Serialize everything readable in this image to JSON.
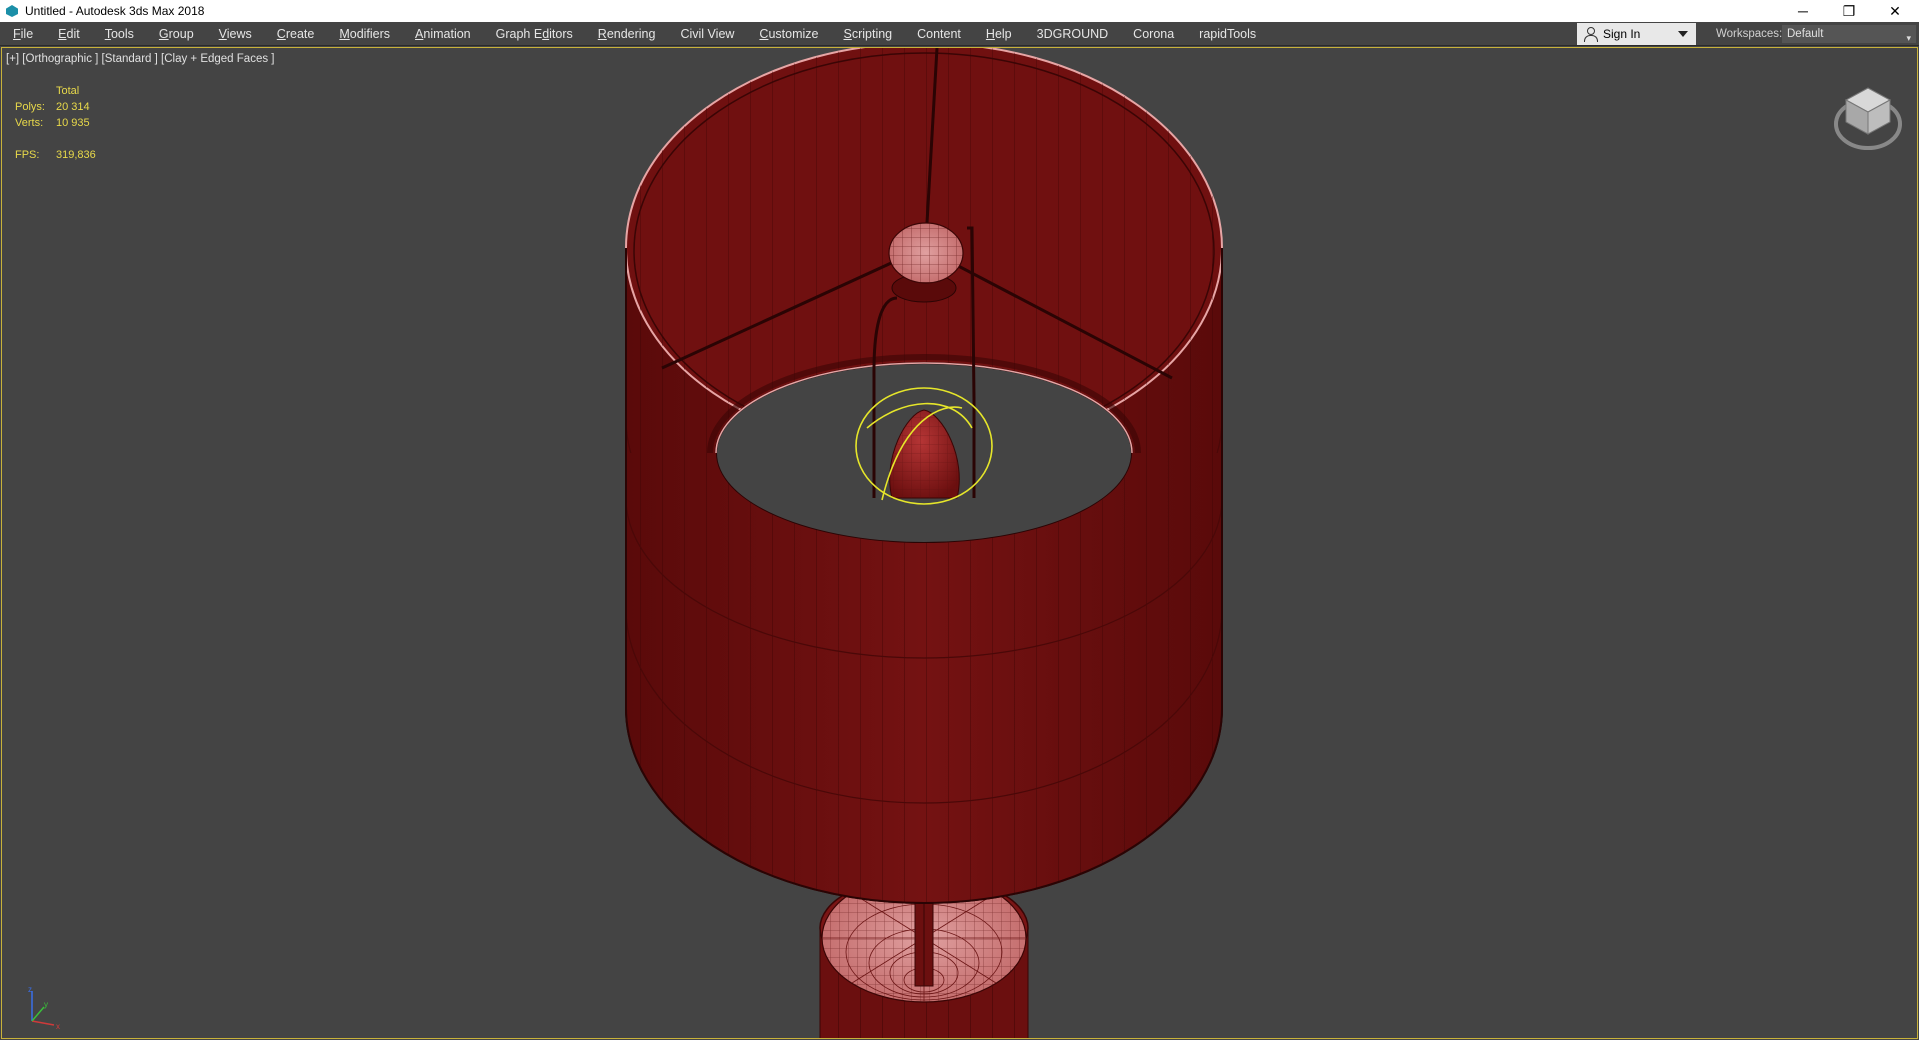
{
  "window": {
    "title": "Untitled - Autodesk 3ds Max 2018",
    "controls": {
      "minimize": "─",
      "restore": "❐",
      "close": "✕"
    }
  },
  "menu": [
    {
      "label": "File",
      "underline": 0
    },
    {
      "label": "Edit",
      "underline": 0
    },
    {
      "label": "Tools",
      "underline": 0
    },
    {
      "label": "Group",
      "underline": 0
    },
    {
      "label": "Views",
      "underline": 0
    },
    {
      "label": "Create",
      "underline": 0
    },
    {
      "label": "Modifiers",
      "underline": 0
    },
    {
      "label": "Animation",
      "underline": 0
    },
    {
      "label": "Graph Editors",
      "underline": 7
    },
    {
      "label": "Rendering",
      "underline": 0
    },
    {
      "label": "Civil View",
      "underline": -1
    },
    {
      "label": "Customize",
      "underline": 0
    },
    {
      "label": "Scripting",
      "underline": 0
    },
    {
      "label": "Content",
      "underline": -1
    },
    {
      "label": "Help",
      "underline": 0
    },
    {
      "label": "3DGROUND",
      "underline": -1
    },
    {
      "label": "Corona",
      "underline": -1
    },
    {
      "label": "rapidTools",
      "underline": -1
    }
  ],
  "account": {
    "sign_in_label": "Sign In"
  },
  "workspaces": {
    "label": "Workspaces:",
    "value": "Default"
  },
  "viewport": {
    "label": "[+] [Orthographic ] [Standard ] [Clay + Edged Faces ]",
    "stats": {
      "header": "Total",
      "polys_label": "Polys:",
      "polys_value": "20 314",
      "verts_label": "Verts:",
      "verts_value": "10 935",
      "fps_label": "FPS:",
      "fps_value": "319,836"
    },
    "axis_labels": {
      "x": "x",
      "y": "y",
      "z": "z"
    }
  },
  "colors": {
    "viewport_bg": "#444444",
    "shade_body": "#6b0f0f",
    "shade_edge": "#3a0505",
    "highlight_pink": "#d88a8a",
    "stats_yellow": "#e8d94a",
    "selection_yellow": "#e6e62a"
  }
}
